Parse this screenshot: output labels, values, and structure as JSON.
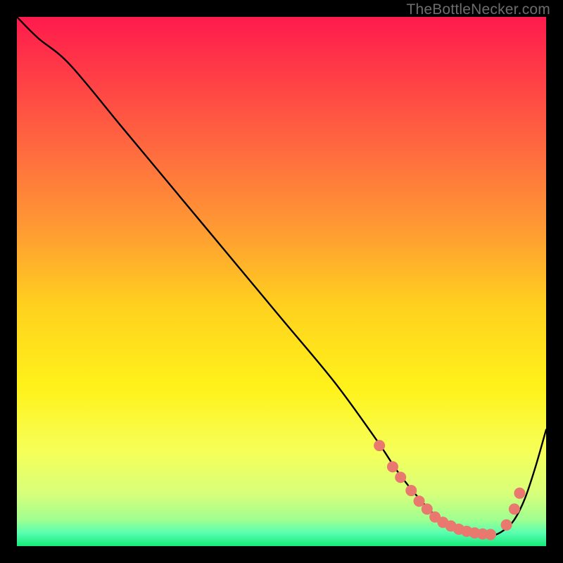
{
  "watermark": "TheBottleNecker.com",
  "chart_data": {
    "type": "line",
    "title": "",
    "xlabel": "",
    "ylabel": "",
    "xlim": [
      0,
      100
    ],
    "ylim": [
      0,
      100
    ],
    "background_gradient": {
      "stops": [
        {
          "offset": 0.0,
          "color": "#ff1a4d"
        },
        {
          "offset": 0.1,
          "color": "#ff3a47"
        },
        {
          "offset": 0.25,
          "color": "#ff6a3f"
        },
        {
          "offset": 0.4,
          "color": "#ff9a33"
        },
        {
          "offset": 0.55,
          "color": "#ffd21e"
        },
        {
          "offset": 0.7,
          "color": "#fff21a"
        },
        {
          "offset": 0.82,
          "color": "#f6ff58"
        },
        {
          "offset": 0.9,
          "color": "#d8ff7a"
        },
        {
          "offset": 0.95,
          "color": "#a0ff90"
        },
        {
          "offset": 0.975,
          "color": "#58ffb0"
        },
        {
          "offset": 1.0,
          "color": "#16e97a"
        }
      ]
    },
    "series": [
      {
        "name": "bottleneck-curve",
        "x": [
          0,
          4,
          10,
          20,
          30,
          40,
          50,
          60,
          68,
          72,
          76,
          80,
          84,
          88,
          90,
          92,
          94,
          96,
          98,
          100
        ],
        "y": [
          100,
          96,
          91,
          79,
          67,
          55,
          43,
          31,
          20,
          14,
          9,
          5,
          3,
          2,
          2,
          3,
          5,
          9,
          15,
          22
        ]
      }
    ],
    "markers": {
      "name": "highlight-points",
      "color": "#e9786f",
      "radius_px": 8,
      "x": [
        68.5,
        71,
        72.5,
        74.5,
        76,
        77.5,
        79,
        80.5,
        82,
        83.5,
        85,
        86.5,
        88,
        89.5,
        92.5,
        94,
        95
      ],
      "y": [
        19,
        15,
        13,
        10.5,
        8.5,
        7,
        5.5,
        4.5,
        3.8,
        3.2,
        2.8,
        2.5,
        2.3,
        2.2,
        4,
        7,
        10
      ]
    }
  }
}
